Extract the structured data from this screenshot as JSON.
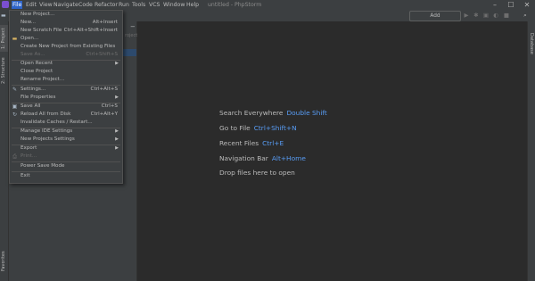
{
  "menubar": {
    "items": [
      "File",
      "Edit",
      "View",
      "Navigate",
      "Code",
      "Refactor",
      "Run",
      "Tools",
      "VCS",
      "Window",
      "Help"
    ],
    "active_index": 0,
    "window_title": "untitled - PhpStorm",
    "controls": {
      "minimize": "–",
      "maximize": "☐",
      "close": "✕"
    }
  },
  "toolbar": {
    "add_configuration": "Add Configuration...",
    "icons": [
      "run-icon",
      "debug-icon",
      "coverage-icon",
      "profile-icon",
      "stop-icon",
      "search-icon"
    ]
  },
  "left_stripe": {
    "project_tab": "1: Project",
    "structure_tab": "2: Structure",
    "bottom_tab": "Favorites"
  },
  "right_stripe": {
    "database_tab": "Database"
  },
  "project_panel": {
    "header_suffix": "−",
    "partial_text": "rojects"
  },
  "file_menu": {
    "items": [
      {
        "label": "New Project...",
        "shortcut": "",
        "disabled": false,
        "submenu": false,
        "icon": ""
      },
      {
        "label": "New...",
        "shortcut": "Alt+Insert",
        "disabled": false,
        "submenu": false,
        "icon": ""
      },
      {
        "label": "New Scratch File",
        "shortcut": "Ctrl+Alt+Shift+Insert",
        "disabled": false,
        "submenu": false,
        "icon": ""
      },
      {
        "label": "Open...",
        "shortcut": "",
        "disabled": false,
        "submenu": false,
        "icon": "folder-icon"
      },
      {
        "label": "Create New Project from Existing Files",
        "shortcut": "",
        "disabled": false,
        "submenu": false,
        "icon": ""
      },
      {
        "label": "Save As...",
        "shortcut": "Ctrl+Shift+S",
        "disabled": true,
        "submenu": false,
        "icon": ""
      },
      {
        "label": "Open Recent",
        "shortcut": "",
        "disabled": false,
        "submenu": true,
        "icon": ""
      },
      {
        "label": "Close Project",
        "shortcut": "",
        "disabled": false,
        "submenu": false,
        "icon": ""
      },
      {
        "label": "Rename Project...",
        "shortcut": "",
        "disabled": false,
        "submenu": false,
        "icon": ""
      },
      {
        "label": "Settings...",
        "shortcut": "Ctrl+Alt+S",
        "disabled": false,
        "submenu": false,
        "icon": "wrench-icon"
      },
      {
        "label": "File Properties",
        "shortcut": "",
        "disabled": false,
        "submenu": true,
        "icon": ""
      },
      {
        "label": "Save All",
        "shortcut": "Ctrl+S",
        "disabled": false,
        "submenu": false,
        "icon": "save-icon"
      },
      {
        "label": "Reload All from Disk",
        "shortcut": "Ctrl+Alt+Y",
        "disabled": false,
        "submenu": false,
        "icon": "reload-icon"
      },
      {
        "label": "Invalidate Caches / Restart...",
        "shortcut": "",
        "disabled": false,
        "submenu": false,
        "icon": ""
      },
      {
        "label": "Manage IDE Settings",
        "shortcut": "",
        "disabled": false,
        "submenu": true,
        "icon": ""
      },
      {
        "label": "New Projects Settings",
        "shortcut": "",
        "disabled": false,
        "submenu": true,
        "icon": ""
      },
      {
        "label": "Export",
        "shortcut": "",
        "disabled": false,
        "submenu": true,
        "icon": ""
      },
      {
        "label": "Print...",
        "shortcut": "",
        "disabled": true,
        "submenu": false,
        "icon": "print-icon"
      },
      {
        "label": "Power Save Mode",
        "shortcut": "",
        "disabled": false,
        "submenu": false,
        "icon": ""
      },
      {
        "label": "Exit",
        "shortcut": "",
        "disabled": false,
        "submenu": false,
        "icon": ""
      }
    ]
  },
  "editor_tips": [
    {
      "label": "Search Everywhere",
      "key": "Double Shift"
    },
    {
      "label": "Go to File",
      "key": "Ctrl+Shift+N"
    },
    {
      "label": "Recent Files",
      "key": "Ctrl+E"
    },
    {
      "label": "Navigation Bar",
      "key": "Alt+Home"
    },
    {
      "label": "Drop files here to open",
      "key": ""
    }
  ],
  "colors": {
    "accent": "#2f65ca",
    "shortcut_blue": "#589df6",
    "menu_bg": "#3c3f41",
    "editor_bg": "#2b2b2b"
  }
}
